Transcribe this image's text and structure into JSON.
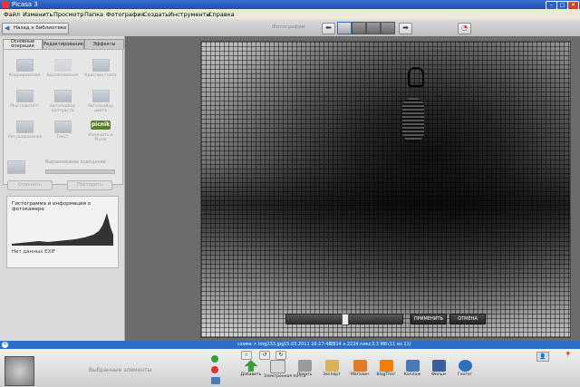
{
  "window": {
    "title": "Picasa 3"
  },
  "menu": [
    "Файл",
    "Изменить",
    "Просмотр",
    "Папка",
    "Фотография",
    "Создать",
    "Инструменты",
    "Справка"
  ],
  "toolbar": {
    "back_label": "Назад к библиотеке",
    "placeholder_label": "Фотографии"
  },
  "left_panel": {
    "tabs": [
      "Основные операции",
      "Редактирование",
      "Эффекты"
    ],
    "tools": [
      {
        "label": "Кадрирование",
        "icon": "crop-icon"
      },
      {
        "label": "Выравнивание",
        "icon": "straighten-icon"
      },
      {
        "label": "Красные глаза",
        "icon": "red-eye-icon"
      },
      {
        "label": "Мне повезёт!",
        "icon": "im-feeling-lucky-icon"
      },
      {
        "label": "Автоподбор контраста",
        "icon": "auto-contrast-icon"
      },
      {
        "label": "Автоподбор цвета",
        "icon": "auto-color-icon"
      },
      {
        "label": "Ретуширование",
        "icon": "retouch-icon"
      },
      {
        "label": "Текст",
        "icon": "text-icon"
      },
      {
        "label": "Изменить в Picnik",
        "icon": "picnik-icon",
        "badge": "picnik"
      }
    ],
    "fill_light_label": "Выравнивание освещения",
    "undo_label": "Отменить",
    "redo_label": "Повторить",
    "histogram_title": "Гистограмма и информация о фотокамере",
    "exif_label": "Нет данных EXIF"
  },
  "controls": {
    "apply_label": "ПРИМЕНИТЬ",
    "cancel_label": "ОТМЕНА"
  },
  "status": {
    "path": "схема > img233.jpg",
    "datetime": "15.03.2011 16:17:48",
    "dimensions": "2814 x 2224 пикс.",
    "size": "3,3 Мб",
    "count": "(11 из 11)"
  },
  "bottom": {
    "selection_label": "Выбранные элементы",
    "actions": [
      {
        "label": "Добавить",
        "icon": "upload-icon",
        "color": "#3a9d3a"
      },
      {
        "label": "Электронная почта",
        "icon": "email-icon",
        "color": "#d8d8d8"
      },
      {
        "label": "Печать",
        "icon": "print-icon",
        "color": "#9a9a9a"
      },
      {
        "label": "Экспорт",
        "icon": "export-icon",
        "color": "#d9b35a"
      },
      {
        "label": "Магазин",
        "icon": "shop-icon",
        "color": "#e07b2a"
      },
      {
        "label": "BlogThis!",
        "icon": "blogger-icon",
        "color": "#f57d00"
      },
      {
        "label": "Коллаж",
        "icon": "collage-icon",
        "color": "#4a7bb8"
      },
      {
        "label": "Фильм",
        "icon": "movie-icon",
        "color": "#3d5f99"
      },
      {
        "label": "Геотег",
        "icon": "geotag-icon",
        "color": "#2f6fbf"
      }
    ]
  }
}
